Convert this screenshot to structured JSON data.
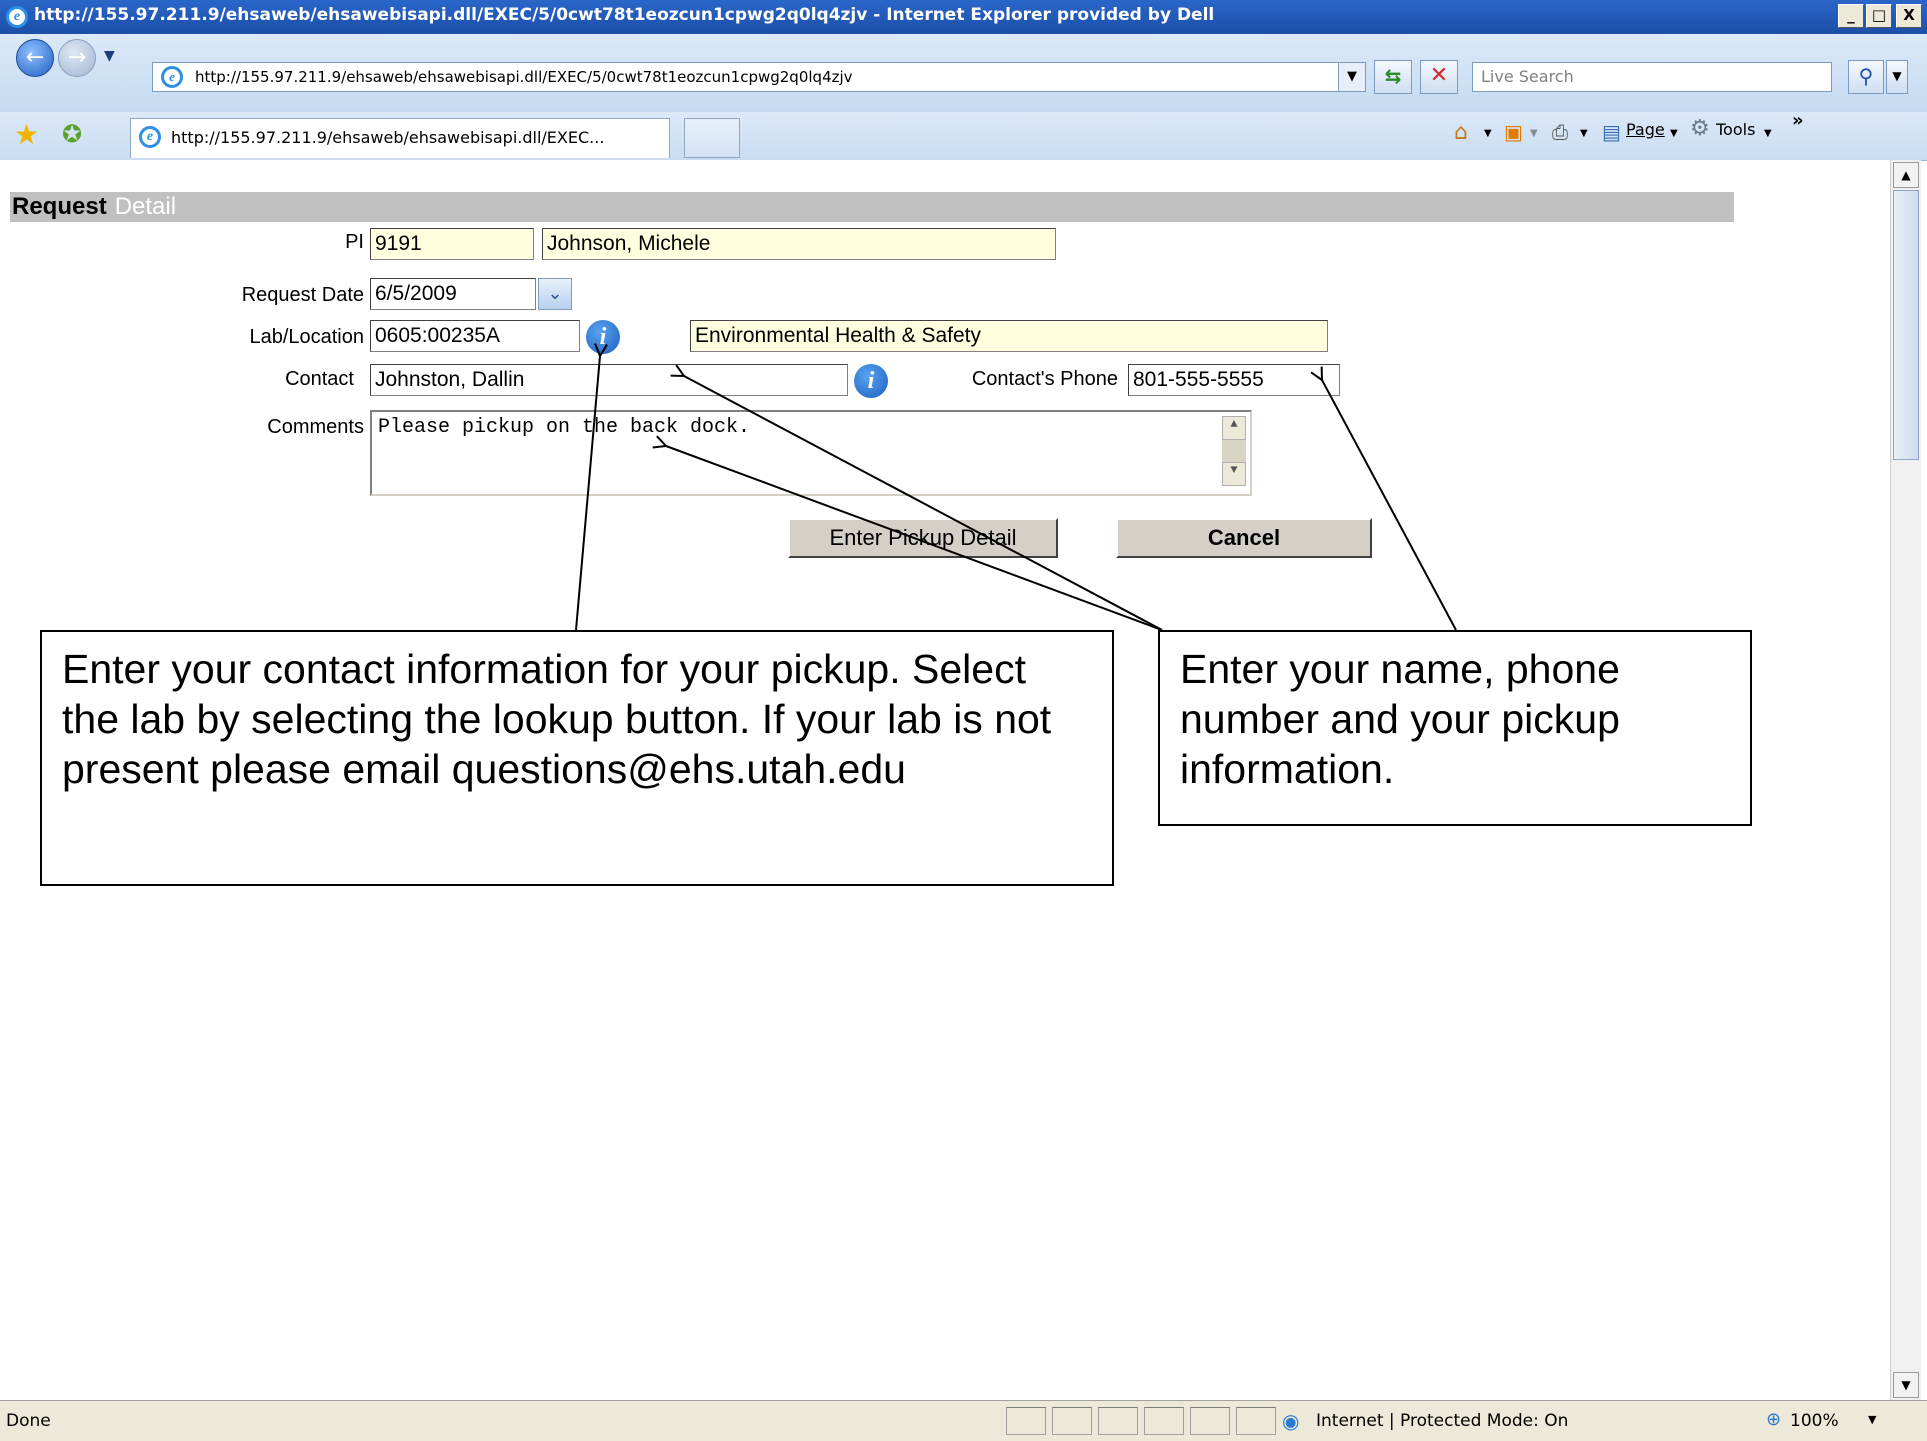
{
  "window": {
    "title": "http://155.97.211.9/ehsaweb/ehsawebisapi.dll/EXEC/5/0cwt78t1eozcun1cpwg2q0lq4zjv - Internet Explorer provided by Dell",
    "minimize": "_",
    "maximize": "□",
    "close": "X"
  },
  "toolbar": {
    "address": "http://155.97.211.9/ehsaweb/ehsawebisapi.dll/EXEC/5/0cwt78t1eozcun1cpwg2q0lq4zjv",
    "search_placeholder": "Live Search",
    "tab_label": "http://155.97.211.9/ehsaweb/ehsawebisapi.dll/EXEC...",
    "page_menu": "Page",
    "tools_menu": "Tools",
    "overflow": "»"
  },
  "form": {
    "header_bold": "Request",
    "header_light": "Detail",
    "pi_label": "PI",
    "pi_id": "9191",
    "pi_name": "Johnson, Michele",
    "request_date_label": "Request Date",
    "request_date": "6/5/2009",
    "lab_location_label": "Lab/Location",
    "lab_location": "0605:00235A",
    "department": "Environmental Health & Safety",
    "contact_label": "Contact",
    "contact": "Johnston, Dallin",
    "contact_phone_label": "Contact's Phone",
    "contact_phone": "801-555-5555",
    "comments_label": "Comments",
    "comments": "Please pickup on the back dock.",
    "enter_pickup_button": "Enter Pickup Detail",
    "cancel_button": "Cancel"
  },
  "callouts": {
    "left": "Enter your contact information for your pickup. Select the lab by selecting the lookup button. If your lab is not present please email questions@ehs.utah.edu",
    "right": "Enter your name, phone number and your pickup information."
  },
  "statusbar": {
    "status_text": "Done",
    "zone": "Internet | Protected Mode: On",
    "zoom": "100%"
  },
  "colors": {
    "field_highlight": "#ffffe0",
    "header_bar": "#c0c0c0",
    "titlebar": "#2a66c9"
  }
}
